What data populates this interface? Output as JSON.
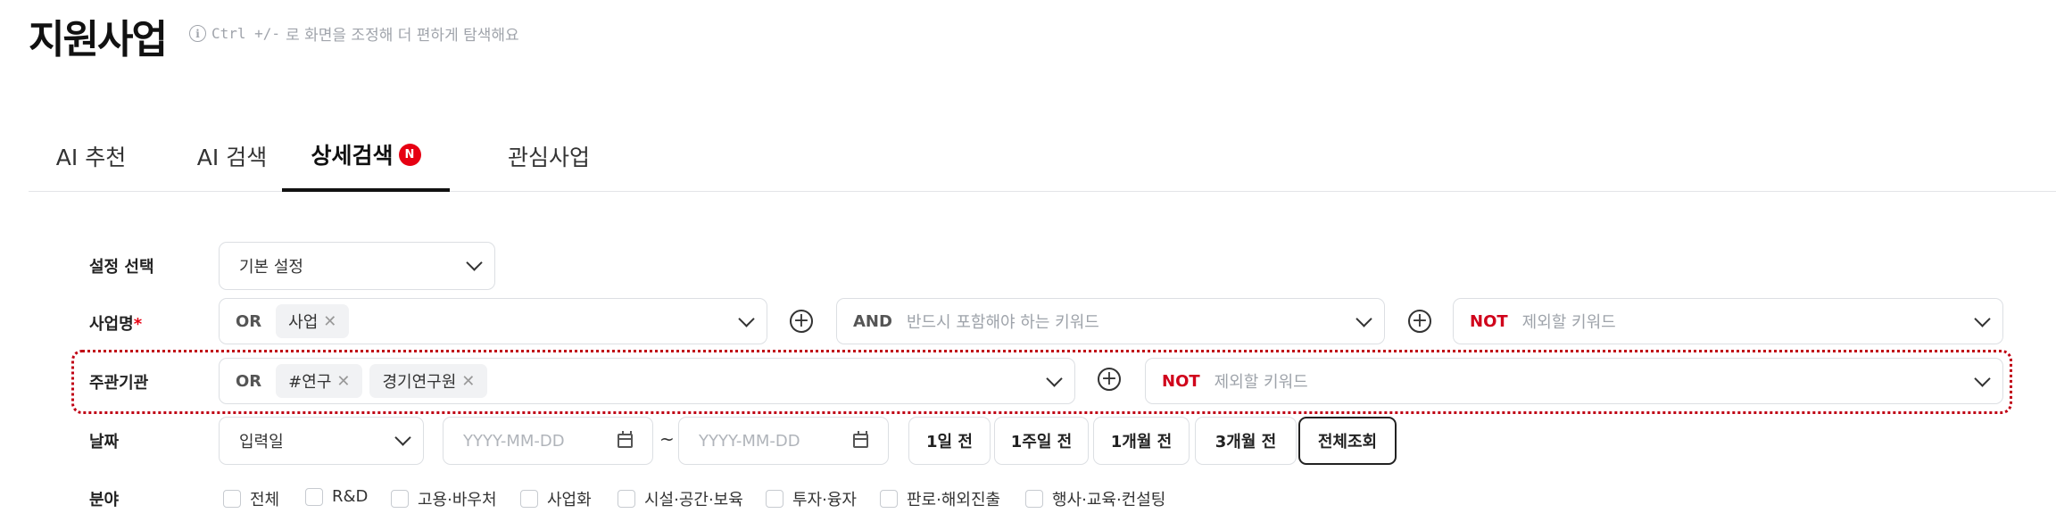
{
  "header": {
    "title": "지원사업",
    "hint_prefix": "Ctrl +/-",
    "hint_suffix": "로 화면을 조정해 더 편하게 탐색해요"
  },
  "tabs": [
    {
      "label": "AI 추천"
    },
    {
      "label": "AI 검색"
    },
    {
      "label": "상세검색",
      "badge": "N"
    },
    {
      "label": "관심사업"
    }
  ],
  "settings": {
    "label": "설정 선택",
    "value": "기본 설정"
  },
  "business_name": {
    "label": "사업명",
    "required": "*",
    "or_label": "OR",
    "or_tags": [
      "사업"
    ],
    "and_label": "AND",
    "and_placeholder": "반드시 포함해야 하는 키워드",
    "not_label": "NOT",
    "not_placeholder": "제외할 키워드"
  },
  "agency": {
    "label": "주관기관",
    "or_label": "OR",
    "or_tags": [
      "#연구",
      "경기연구원"
    ],
    "not_label": "NOT",
    "not_placeholder": "제외할 키워드"
  },
  "date": {
    "label": "날짜",
    "type_value": "입력일",
    "start_placeholder": "YYYY-MM-DD",
    "end_placeholder": "YYYY-MM-DD",
    "separator": "~",
    "quick": [
      "1일 전",
      "1주일 전",
      "1개월 전",
      "3개월 전",
      "전체조회"
    ],
    "selected_quick": "전체조회"
  },
  "field": {
    "label": "분야",
    "options": [
      "전체",
      "R&D",
      "고용·바우처",
      "사업화",
      "시설·공간·보육",
      "투자·융자",
      "판로·해외진출",
      "행사·교육·컨설팅"
    ]
  },
  "colors": {
    "accent_red": "#e60012",
    "not_red": "#d0021b",
    "border": "#dcdfe3"
  },
  "icons": [
    "info-icon",
    "chevron-down-icon",
    "plus-circle-icon",
    "close-icon",
    "calendar-icon"
  ]
}
